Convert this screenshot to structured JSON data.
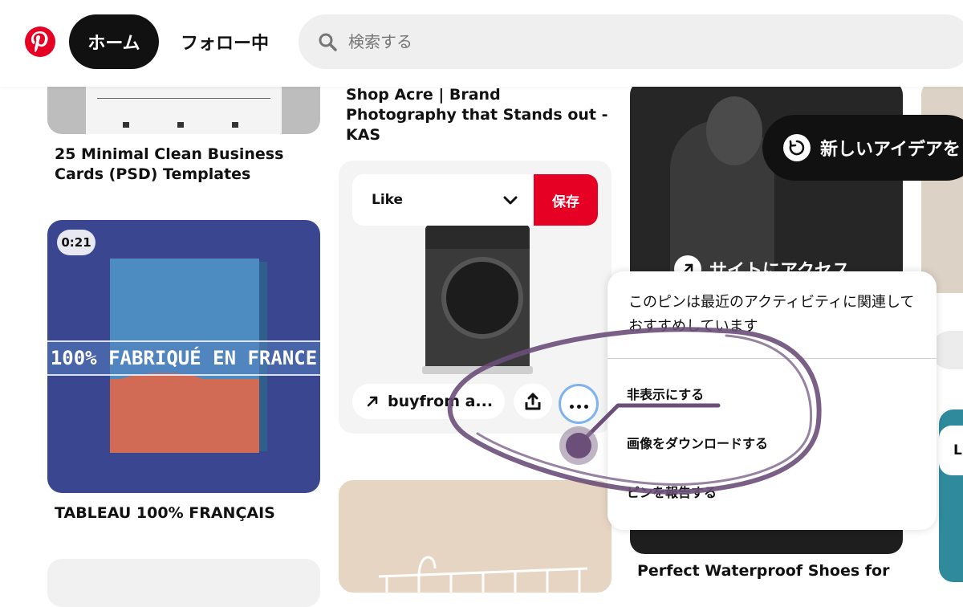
{
  "header": {
    "logo_icon": "pinterest-logo-icon",
    "home_label": "ホーム",
    "following_label": "フォロー中",
    "search_placeholder": "検索する"
  },
  "pins": {
    "business_cards": {
      "title": "25 Minimal Clean Business Cards (PSD) Templates"
    },
    "tableau": {
      "duration": "0:21",
      "banner_text": "100% FABRIQUÉ EN FRANCE",
      "title": "TABLEAU 100% FRANÇAIS"
    },
    "shop_acre": {
      "title": "Shop Acre | Brand Photography that Stands out - KAS"
    },
    "washer": {
      "board_label": "Like",
      "save_label": "保存",
      "link_label": "buyfrom a...",
      "share_icon": "share-icon",
      "more_icon": "more-dots-icon"
    },
    "dark_video": {
      "visit_label": "サイトにアクセス"
    },
    "shoes": {
      "title": "Perfect Waterproof Shoes for"
    },
    "edge_button_label": "Li"
  },
  "new_ideas": {
    "label": "新しいアイデアを"
  },
  "menu": {
    "info": "このピンは最近のアクティビティに関連しておすすめしています",
    "items": [
      {
        "label": "非表示にする"
      },
      {
        "label": "画像をダウンロードする"
      },
      {
        "label": "ピンを報告する"
      }
    ]
  },
  "colors": {
    "brand_red": "#e60023",
    "scribble": "#6b4f79"
  }
}
